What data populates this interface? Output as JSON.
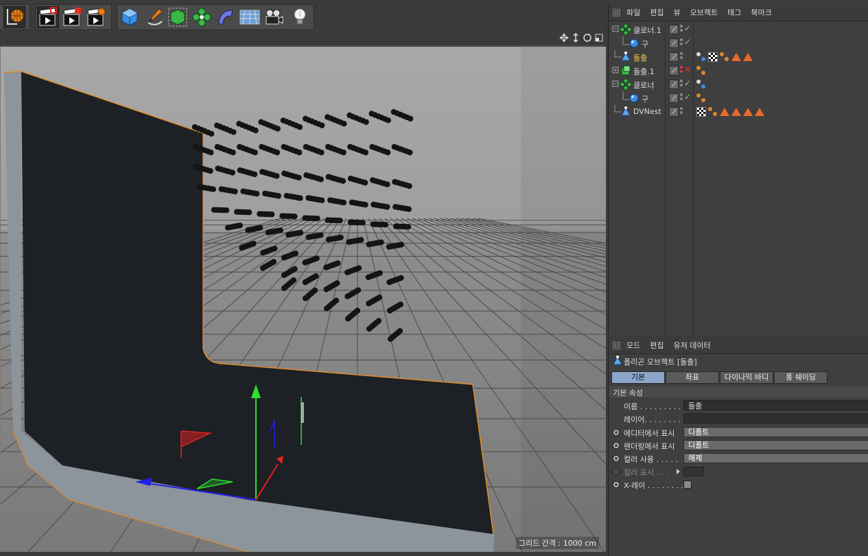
{
  "object_manager": {
    "menu": [
      "파일",
      "편집",
      "뷰",
      "오브젝트",
      "태그",
      "북마크"
    ],
    "objects": [
      {
        "name": "클로너.1",
        "status": "ok",
        "icon": "cloner-icon"
      },
      {
        "name": "구",
        "status": "ok",
        "icon": "sphere-icon"
      },
      {
        "name": "돌출",
        "status": "none",
        "icon": "polygon-object-icon"
      },
      {
        "name": "돌출.1",
        "status": "off",
        "icon": "extrude-icon"
      },
      {
        "name": "클로너",
        "status": "ok",
        "icon": "cloner-icon"
      },
      {
        "name": "구",
        "status": "ok",
        "icon": "sphere-icon"
      },
      {
        "name": "DVNest",
        "status": "none",
        "icon": "polygon-object-icon"
      }
    ]
  },
  "attribute_manager": {
    "menu": [
      "모드",
      "편집",
      "유저 데이터"
    ],
    "title": "폴리곤 오브젝트 [돌출]",
    "tabs": [
      "기본",
      "좌표",
      "다이나믹 바디",
      "퐁 쉐이딩"
    ],
    "active_tab": "기본",
    "section": "기본 속성",
    "rows": {
      "name_label": "이름 . . . . . . . . . .",
      "name_value": "돌출",
      "layer_label": "레이어. . . . . . . . .",
      "editor_label": "에디터에서 표시",
      "editor_value": "디폴트",
      "render_label": "렌더링에서 표시",
      "render_value": "디폴트",
      "color_label": "컬러 사용 . . . . .",
      "color_value": "해제",
      "display_color_label": "컬러 표시 . . .",
      "xray_label": "X-레이 . . . . . . . ."
    }
  },
  "viewport": {
    "grid_label": "그리드 간격 : 1000 cm"
  },
  "colors": {
    "panel_bg": "#3f3f3f",
    "active_tab": "#8aa6cc",
    "selected_name": "#f2c84b",
    "check_green": "#6be05c",
    "cross_red": "#e03a3a",
    "selection_outline": "#e08a2a"
  }
}
